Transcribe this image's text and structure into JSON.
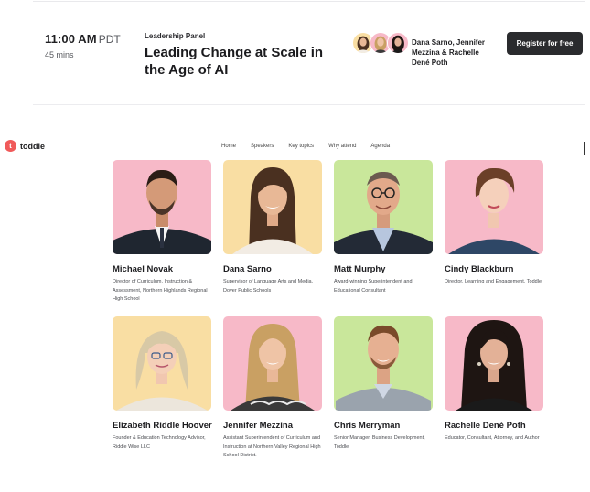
{
  "session": {
    "time": "11:00 AM",
    "timezone": "PDT",
    "duration": "45 mins",
    "type": "Leadership Panel",
    "title": "Leading Change at Scale in the Age of AI",
    "speaker_names": "Dana Sarno, Jennifer Mezzina & Rachelle Dené Poth",
    "register_label": "Register for free"
  },
  "site": {
    "logo_mark": "t",
    "logo_text": "toddle",
    "nav": [
      "Home",
      "Speakers",
      "Key topics",
      "Why attend",
      "Agenda"
    ]
  },
  "speakers": [
    {
      "name": "Michael Novak",
      "role": "Director of Curriculum, Instruction & Assessment, Northern Highlands Regional High School",
      "bg": "#f7b9c8"
    },
    {
      "name": "Dana Sarno",
      "role": "Supervisor of Language Arts and Media, Dover Public Schools",
      "bg": "#f9dea3"
    },
    {
      "name": "Matt Murphy",
      "role": "Award-winning Superintendent and Educational Consultant",
      "bg": "#c9e79b"
    },
    {
      "name": "Cindy Blackburn",
      "role": "Director, Learning and Engagement, Toddle",
      "bg": "#f7b9c8"
    },
    {
      "name": "Elizabeth Riddle Hoover",
      "role": "Founder & Education Technology Advisor, Riddle Wise LLC",
      "bg": "#f9dea3"
    },
    {
      "name": "Jennifer Mezzina",
      "role": "Assistant Superintendent of Curriculum and Instruction at Northern Valley Regional High School District.",
      "bg": "#f7b9c8"
    },
    {
      "name": "Chris Merryman",
      "role": "Senior Manager, Business Development, Toddle",
      "bg": "#c9e79b"
    },
    {
      "name": "Rachelle Dené Poth",
      "role": "Educator, Consultant, Attorney, and Author",
      "bg": "#f7b9c8"
    }
  ]
}
